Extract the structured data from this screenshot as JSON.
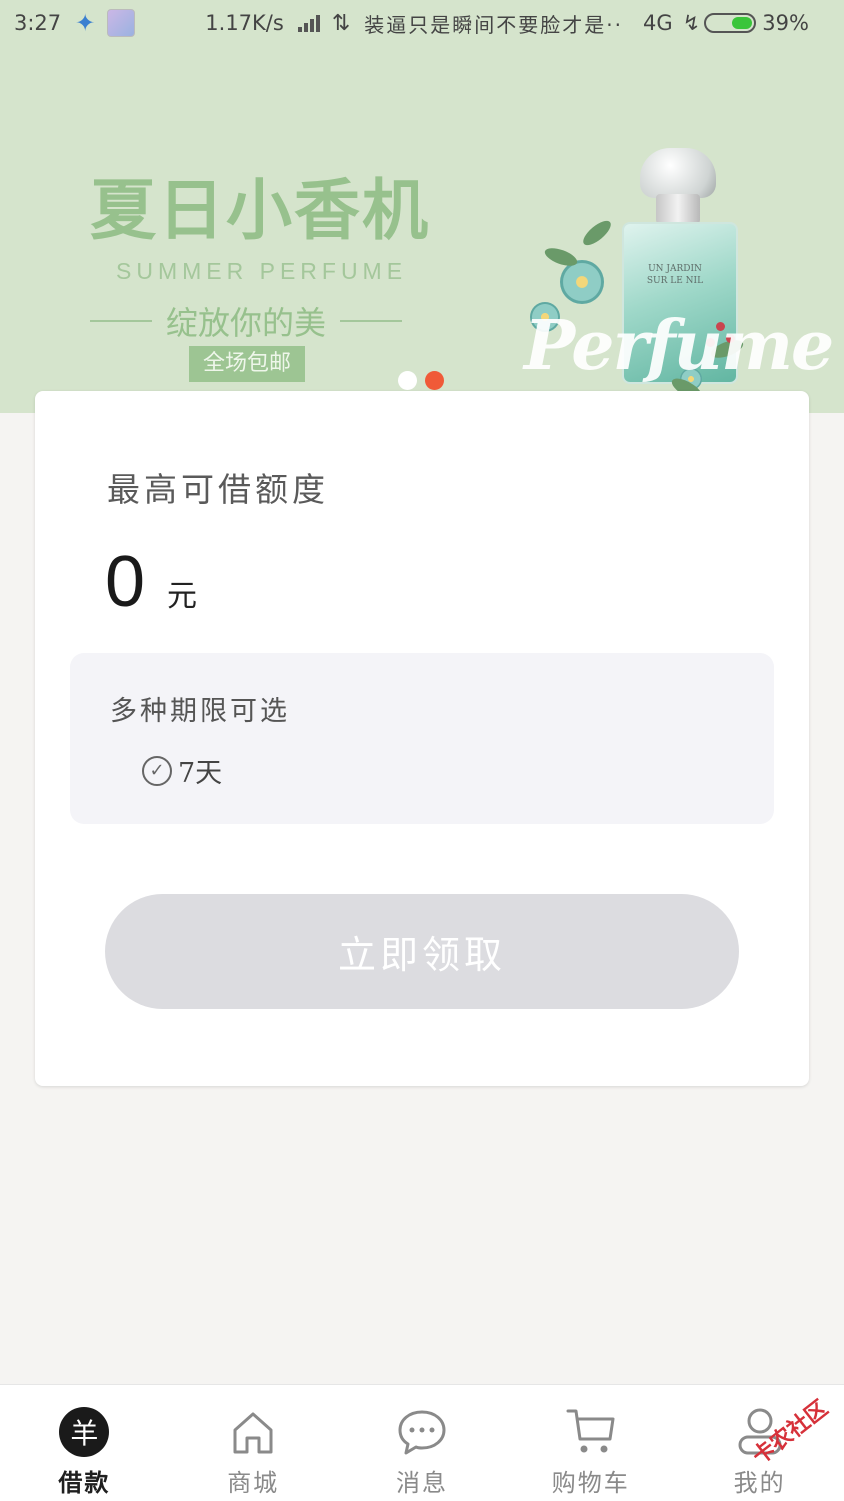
{
  "status_bar": {
    "time": "3:27",
    "network_speed": "1.17K/s",
    "notification_text": "装逼只是瞬间不要脸才是··",
    "network_type": "4G",
    "battery_percent": "39%",
    "battery_level": 0.39,
    "icons": [
      "bird-app-icon",
      "avatar-app-icon",
      "signal-icon",
      "data-arrows-icon",
      "charging-icon",
      "battery-icon"
    ]
  },
  "banner": {
    "title": "夏日小香机",
    "subtitle": "SUMMER PERFUME",
    "slogan": "绽放你的美",
    "tag": "全场包邮",
    "script_text": "Perfume",
    "bottle_label": "UN JARDIN SUR LE NIL",
    "slide_count": 2,
    "active_slide": 2
  },
  "card": {
    "limit_label": "最高可借额度",
    "amount_value": "0",
    "amount_unit": "元",
    "term_title": "多种期限可选",
    "term_option": "7天",
    "claim_button": "立即领取"
  },
  "bottom_nav": {
    "items": [
      {
        "label": "借款",
        "icon": "loan-icon",
        "glyph": "羊",
        "active": true
      },
      {
        "label": "商城",
        "icon": "home-icon",
        "active": false
      },
      {
        "label": "消息",
        "icon": "chat-icon",
        "active": false
      },
      {
        "label": "购物车",
        "icon": "cart-icon",
        "active": false
      },
      {
        "label": "我的",
        "icon": "user-icon",
        "active": false
      }
    ]
  },
  "watermark": "卡农社区",
  "colors": {
    "banner_bg": "#d5e4cc",
    "banner_text": "#97c18d",
    "active_dot": "#f05a38",
    "button_disabled": "#dcdce0",
    "page_bg": "#f5f4f2"
  }
}
